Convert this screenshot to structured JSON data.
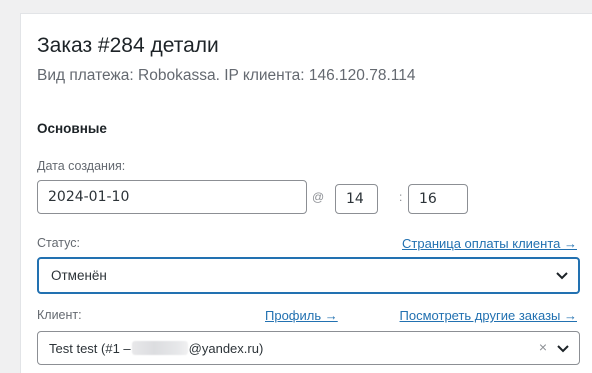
{
  "order": {
    "title": "Заказ #284 детали",
    "payment_info": "Вид платежа: Robokassa. IP клиента: 146.120.78.114"
  },
  "general": {
    "heading": "Основные",
    "date_created_label": "Дата создания:",
    "date_value": "2024-01-10",
    "at_sign": "@",
    "hour_value": "14",
    "time_sep": ":",
    "minute_value": "16",
    "status_label": "Статус:",
    "customer_payment_page_link": "Страница оплаты клиента →",
    "status_value": "Отменён",
    "customer_label": "Клиент:",
    "profile_link": "Профиль →",
    "other_orders_link": "Посмотреть другие заказы →",
    "customer_value_prefix": "Test test (#1 –",
    "customer_value_suffix": "@yandex.ru)",
    "clear_icon": "×"
  },
  "icons": {
    "status_dropdown": "chevron-down-icon",
    "customer_dropdown": "chevron-down-icon",
    "customer_clear": "close-icon"
  },
  "colors": {
    "accent": "#2271b1",
    "text": "#1d2327",
    "muted": "#646970",
    "border": "#8c8f94"
  }
}
